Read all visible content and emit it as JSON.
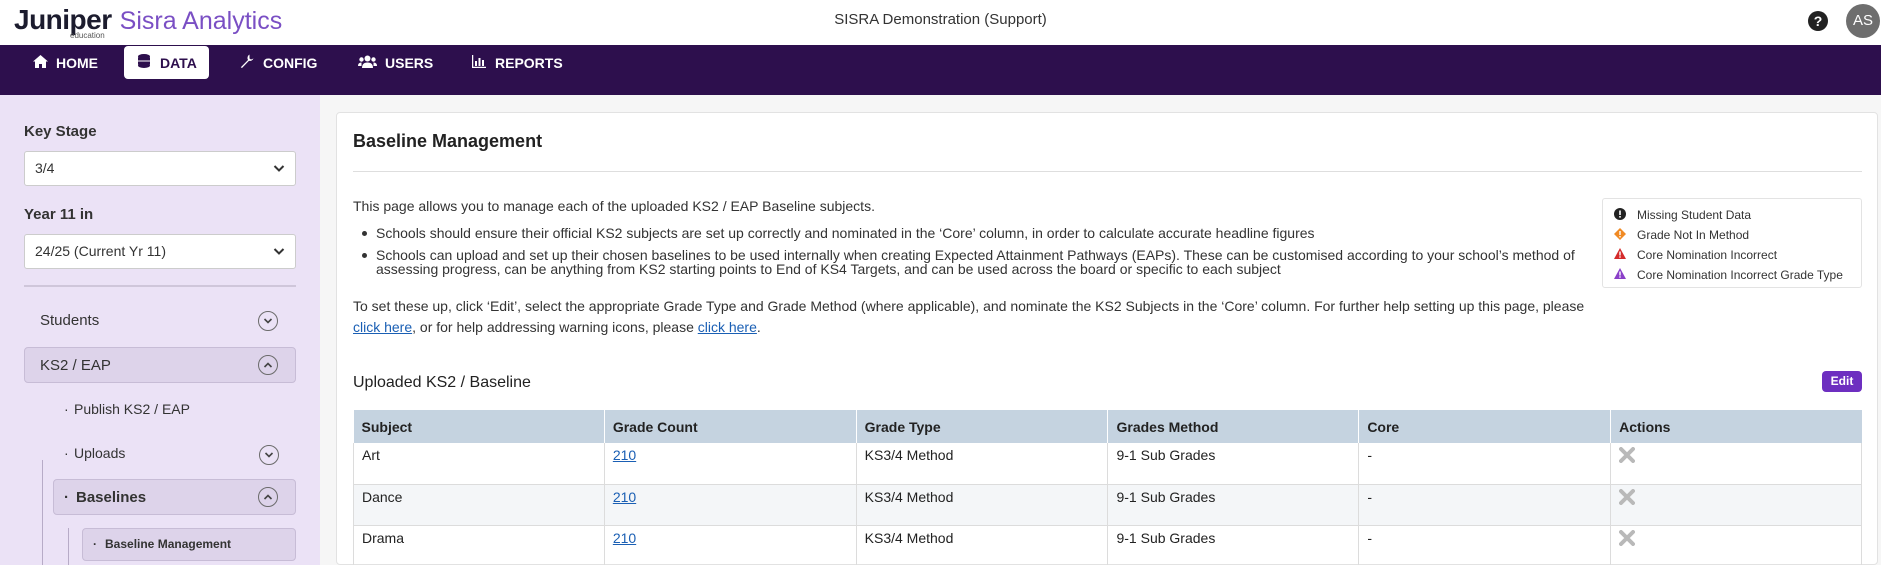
{
  "header": {
    "brand_name": "Juniper",
    "brand_sub": "education",
    "app_name": "Sisra Analytics",
    "org_name": "SISRA Demonstration (Support)",
    "help_label": "?",
    "avatar_initials": "AS"
  },
  "nav": {
    "items": [
      {
        "label": "HOME",
        "icon": "home-icon"
      },
      {
        "label": "DATA",
        "icon": "database-icon",
        "active": true
      },
      {
        "label": "CONFIG",
        "icon": "wrench-icon"
      },
      {
        "label": "USERS",
        "icon": "users-icon"
      },
      {
        "label": "REPORTS",
        "icon": "chart-icon"
      }
    ]
  },
  "sidebar": {
    "key_stage_label": "Key Stage",
    "key_stage_value": "3/4",
    "year_label": "Year 11 in",
    "year_value": "24/25 (Current Yr 11)",
    "items": [
      {
        "label": "Students"
      },
      {
        "label": "KS2 / EAP"
      },
      {
        "label": "Publish KS2 / EAP"
      },
      {
        "label": "Uploads"
      },
      {
        "label": "Baselines"
      },
      {
        "label": "Baseline Management"
      }
    ]
  },
  "main": {
    "title": "Baseline Management",
    "intro": "This page allows you to manage each of the uploaded KS2 / EAP Baseline subjects.",
    "bullets": [
      "Schools should ensure their official KS2 subjects are set up correctly and nominated in the ‘Core’ column, in order to calculate accurate headline figures",
      "Schools can upload and set up their chosen baselines to be used internally when creating Expected Attainment Pathways (EAPs). These can be customised according to your school’s method of assessing progress, can be anything from KS2 starting points to End of KS4 Targets, and can be used across the board or specific to each subject"
    ],
    "para_part1": "To set these up, click ‘Edit’, select the appropriate Grade Type and Grade Method (where applicable), and nominate the KS2 Subjects in the ‘Core’ column. For further help setting up this page, please ",
    "link1": "click here",
    "para_part2": ", or for help addressing warning icons, please ",
    "link2": "click here",
    "para_part3": ".",
    "legend": [
      {
        "label": "Missing Student Data",
        "icon": "exclamation-circle-icon",
        "color": "#222222"
      },
      {
        "label": "Grade Not In Method",
        "icon": "diamond-warning-icon",
        "color": "#f08a24"
      },
      {
        "label": "Core Nomination Incorrect",
        "icon": "triangle-warning-icon",
        "color": "#d42b2b"
      },
      {
        "label": "Core Nomination Incorrect Grade Type",
        "icon": "triangle-warning-purple-icon",
        "color": "#8a3fc8"
      }
    ],
    "section_title": "Uploaded KS2 / Baseline",
    "edit_label": "Edit",
    "table": {
      "headers": [
        "Subject",
        "Grade Count",
        "Grade Type",
        "Grades Method",
        "Core",
        "Actions"
      ],
      "rows": [
        {
          "subject": "Art",
          "count": "210",
          "type": "KS3/4 Method",
          "method": "9-1 Sub Grades",
          "core": "-"
        },
        {
          "subject": "Dance",
          "count": "210",
          "type": "KS3/4 Method",
          "method": "9-1 Sub Grades",
          "core": "-"
        },
        {
          "subject": "Drama",
          "count": "210",
          "type": "KS3/4 Method",
          "method": "9-1 Sub Grades",
          "core": "-"
        }
      ]
    }
  },
  "colors": {
    "nav_bg": "#2d0f4d",
    "accent": "#6d2fc0",
    "sidebar_bg": "#ebe2f6",
    "table_header": "#c5d3e0"
  }
}
